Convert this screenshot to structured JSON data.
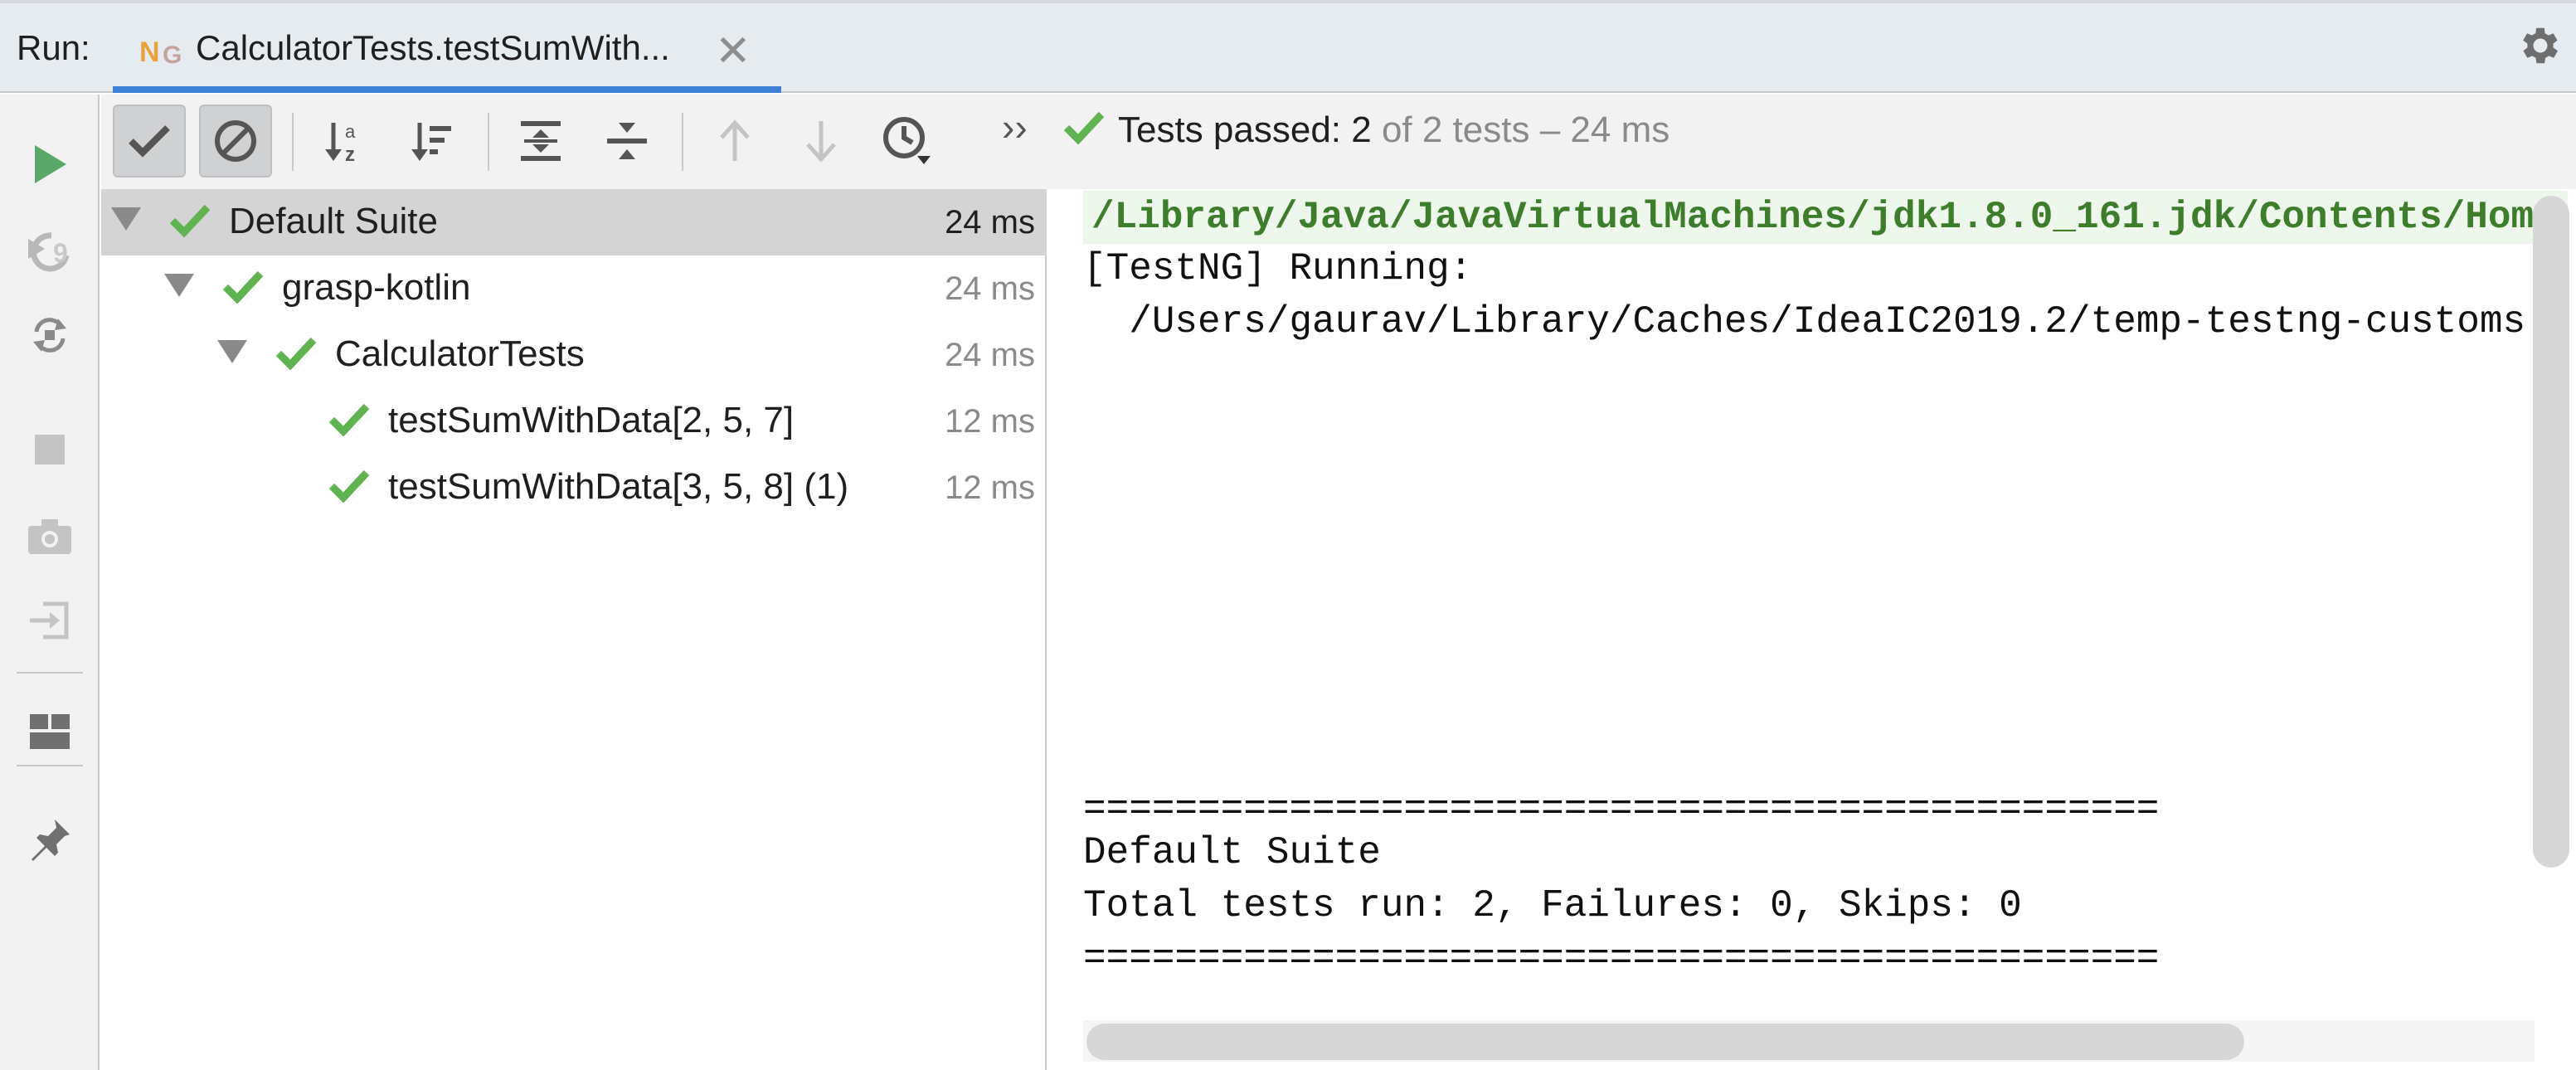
{
  "header": {
    "run_label": "Run:",
    "tab_icon_letters": [
      "N",
      "G"
    ],
    "tab_title": "CalculatorTests.testSumWith...",
    "close_glyph": "✕",
    "accent_color": "#3f7fd6"
  },
  "left_toolbar": {
    "icons": [
      "run-icon",
      "rerun-failed-icon",
      "toggle-auto-test-icon",
      "stop-icon",
      "screenshot-icon",
      "import-tests-icon",
      "layout-icon",
      "pin-icon"
    ]
  },
  "tree_toolbar": {
    "icons": [
      "show-passed-icon",
      "show-ignored-icon",
      "sort-alphabetically-icon",
      "sort-by-duration-icon",
      "expand-all-icon",
      "collapse-all-icon",
      "previous-failed-icon",
      "next-failed-icon",
      "test-history-icon"
    ],
    "more_glyph": "››"
  },
  "status": {
    "label": "Tests passed: 2",
    "rest": " of 2 tests – 24 ms",
    "pass_color": "#5fb350"
  },
  "tree": [
    {
      "name": "Default Suite",
      "duration": "24 ms"
    },
    {
      "name": "grasp-kotlin",
      "duration": "24 ms"
    },
    {
      "name": "CalculatorTests",
      "duration": "24 ms"
    },
    {
      "name": "testSumWithData[2, 5, 7]",
      "duration": "12 ms"
    },
    {
      "name": "testSumWithData[3, 5, 8] (1)",
      "duration": "12 ms"
    }
  ],
  "console": {
    "command": "/Library/Java/JavaVirtualMachines/jdk1.8.0_161.jdk/Contents/Hom",
    "running": "[TestNG] Running:",
    "path": "  /Users/gaurav/Library/Caches/IdeaIC2019.2/temp-testng-customs",
    "separator": "===============================================",
    "suite": "Default Suite",
    "summary": "Total tests run: 2, Failures: 0, Skips: 0"
  }
}
